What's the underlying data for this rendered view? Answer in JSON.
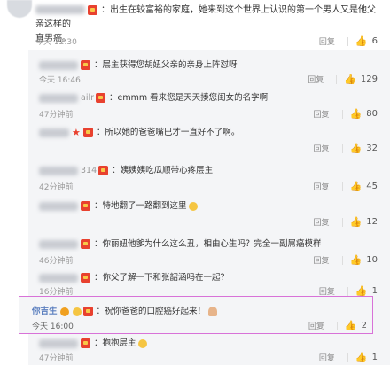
{
  "top_comment": {
    "text_line1": "：出生在较富裕的家庭，她来到这个世界上认识的第一个男人又是他父亲这样的",
    "text_line2": "直男癌。",
    "time": "今天 12:30",
    "reply_label": "回复",
    "likes": "6"
  },
  "replies": [
    {
      "text": "：层主获得您胡妞父亲的亲身上阵怼呀",
      "time": "今天 16:46",
      "likes": "129"
    },
    {
      "text": "：emmm 看来您是天天揍您闺女的名字啊",
      "name_tail": "ailr",
      "time": "47分钟前",
      "likes": "80"
    },
    {
      "text": "：所以她的爸爸嘴巴才一直好不了啊。",
      "time": "",
      "likes": "32"
    },
    {
      "text": "：姨姨姨吃瓜顺带心疼层主",
      "name_tail": "314",
      "time": "42分钟前",
      "likes": "45"
    },
    {
      "text": "：特地翻了一路翻到这里",
      "time": "",
      "likes": "12"
    },
    {
      "text": "：你丽妞他爹为什么这么丑，相由心生吗？完全一副屌癌模样",
      "time": "46分钟前",
      "likes": "10"
    },
    {
      "text": "：你父了解一下和张韶涵吗在一起？",
      "time": "16分钟前",
      "likes": "1"
    }
  ],
  "highlighted_reply": {
    "name": "你吉生",
    "text": "：祝你爸爸的口腔癌好起来！",
    "time": "今天 16:00",
    "likes": "2"
  },
  "last_reply": {
    "text": "：抱抱层主",
    "time": "47分钟前",
    "likes": "1"
  },
  "icons": {
    "thumb": "thumbs-up-icon",
    "vip": "vip-badge-icon"
  },
  "colors": {
    "highlight_border": "#d872d8",
    "name_blue": "#5b7fbf",
    "badge_red": "#e8412f"
  }
}
